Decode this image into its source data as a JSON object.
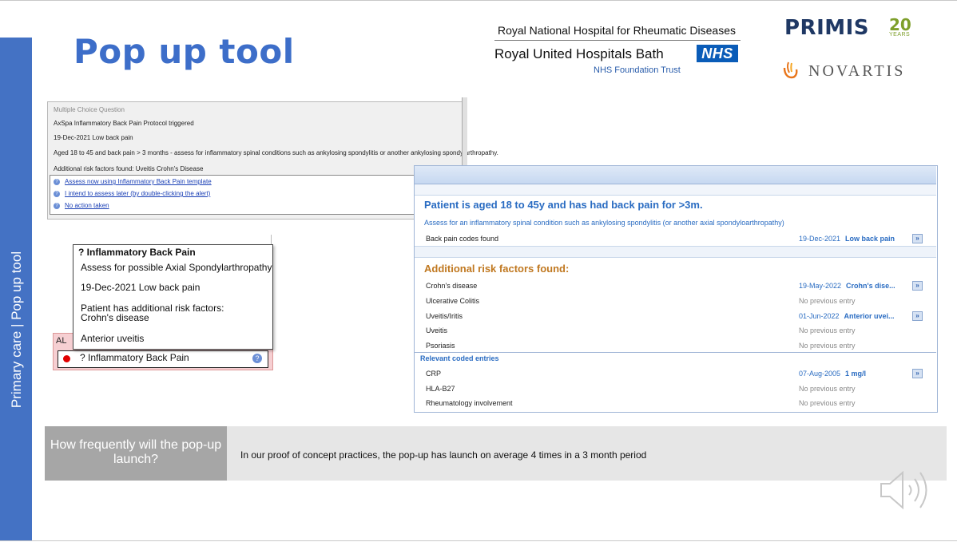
{
  "sidebar": {
    "text": "Primary care  |  Pop up tool"
  },
  "title": "Pop up tool",
  "logos": {
    "rnhrd": "Royal National Hospital for Rheumatic Diseases",
    "ruh": "Royal United Hospitals Bath",
    "nhs": "NHS",
    "nhs_trust": "NHS Foundation Trust",
    "primis": "PRIMIS",
    "primis_20": "20",
    "primis_years": "YEARS",
    "novartis": "NOVARTIS"
  },
  "mcq": {
    "window_title": "Multiple Choice Question",
    "line1": "AxSpa Inflammatory Back Pain Protocol triggered",
    "line2": "19-Dec-2021 Low back pain",
    "line3": "Aged 18 to 45 and back pain > 3 months - assess for inflammatory spinal conditions such as ankylosing spondylitis or another ankylosing spondylarthropathy.",
    "line4": "Additional risk factors found: Uveitis Crohn's Disease",
    "options": [
      "Assess now using Inflammatory Back Pain template",
      "I intend to assess later (by double-clicking the alert)",
      "No action taken"
    ]
  },
  "tooltip": {
    "title": "? Inflammatory Back Pain",
    "line1": "Assess for possible Axial Spondylarthropathy",
    "line2": "19-Dec-2021 Low back pain",
    "line3": "Patient has additional risk factors:",
    "line4": "Crohn's disease",
    "line5": "Anterior uveitis"
  },
  "alert": {
    "strip_label": "AL",
    "label": "? Inflammatory Back Pain"
  },
  "panel": {
    "heading": "Patient is aged 18 to 45y and has had back pain for >3m.",
    "subheading": "Assess for an inflammatory spinal condition such as ankylosing spondylitis (or another axial spondyloarthropathy)",
    "back_pain": {
      "label": "Back pain codes found",
      "date": "19-Dec-2021",
      "value": "Low back pain"
    },
    "risk_heading": "Additional risk factors found:",
    "risk_rows": [
      {
        "label": "Crohn's disease",
        "date": "19-May-2022",
        "value": "Crohn's dise...",
        "link": true
      },
      {
        "label": "Ulcerative Colitis",
        "date": "",
        "value": "No previous entry",
        "link": false
      },
      {
        "label": "Uveitis/Iritis",
        "date": "01-Jun-2022",
        "value": "Anterior uvei...",
        "link": true
      },
      {
        "label": "Uveitis",
        "date": "",
        "value": "No previous entry",
        "link": false
      },
      {
        "label": "Psoriasis",
        "date": "",
        "value": "No previous entry",
        "link": false
      }
    ],
    "coded_heading": "Relevant coded entries",
    "coded_rows": [
      {
        "label": "CRP",
        "date": "07-Aug-2005",
        "value": "1 mg/l",
        "link": true
      },
      {
        "label": "HLA-B27",
        "date": "",
        "value": "No previous entry",
        "link": false
      },
      {
        "label": "Rheumatology involvement",
        "date": "",
        "value": "No previous entry",
        "link": false
      }
    ],
    "arrow_glyph": "»"
  },
  "bottom": {
    "question": "How frequently will the pop-up launch?",
    "answer": "In our proof of concept practices, the pop-up has launch on average 4 times in a 3 month period"
  },
  "colors": {
    "accent": "#4472c4",
    "title_blue": "#3d6ec9",
    "risk_orange": "#c07820",
    "alert_red": "#e00000"
  }
}
